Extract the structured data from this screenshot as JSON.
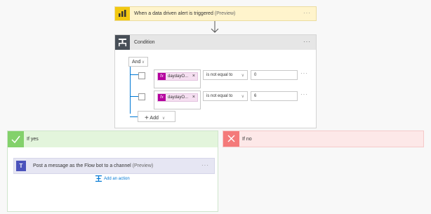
{
  "trigger": {
    "title": "When a data driven alert is triggered",
    "preview": "(Preview)",
    "more": "···",
    "icon": "power-bi-icon",
    "color": "#f2c811"
  },
  "condition": {
    "title": "Condition",
    "more": "···",
    "icon": "condition-icon",
    "group_op": "And",
    "rows": [
      {
        "token": "daydayO...",
        "operator": "is not equal to",
        "value": "0",
        "more": "···"
      },
      {
        "token": "daydayO...",
        "operator": "is not equal to",
        "value": "6",
        "more": "···"
      }
    ],
    "add_label": "Add",
    "add_plus": "+"
  },
  "branches": {
    "yes": {
      "title": "If yes",
      "color": "#83d16b",
      "action": {
        "title": "Post a message as the Flow bot to a channel",
        "preview": "(Preview)",
        "more": "···",
        "icon": "teams-icon",
        "icon_text": "T"
      },
      "add_action": "Add an action"
    },
    "no": {
      "title": "If no",
      "color": "#f47a7a"
    }
  },
  "token_fx": "fx",
  "token_remove": "×",
  "chevron": "∨"
}
